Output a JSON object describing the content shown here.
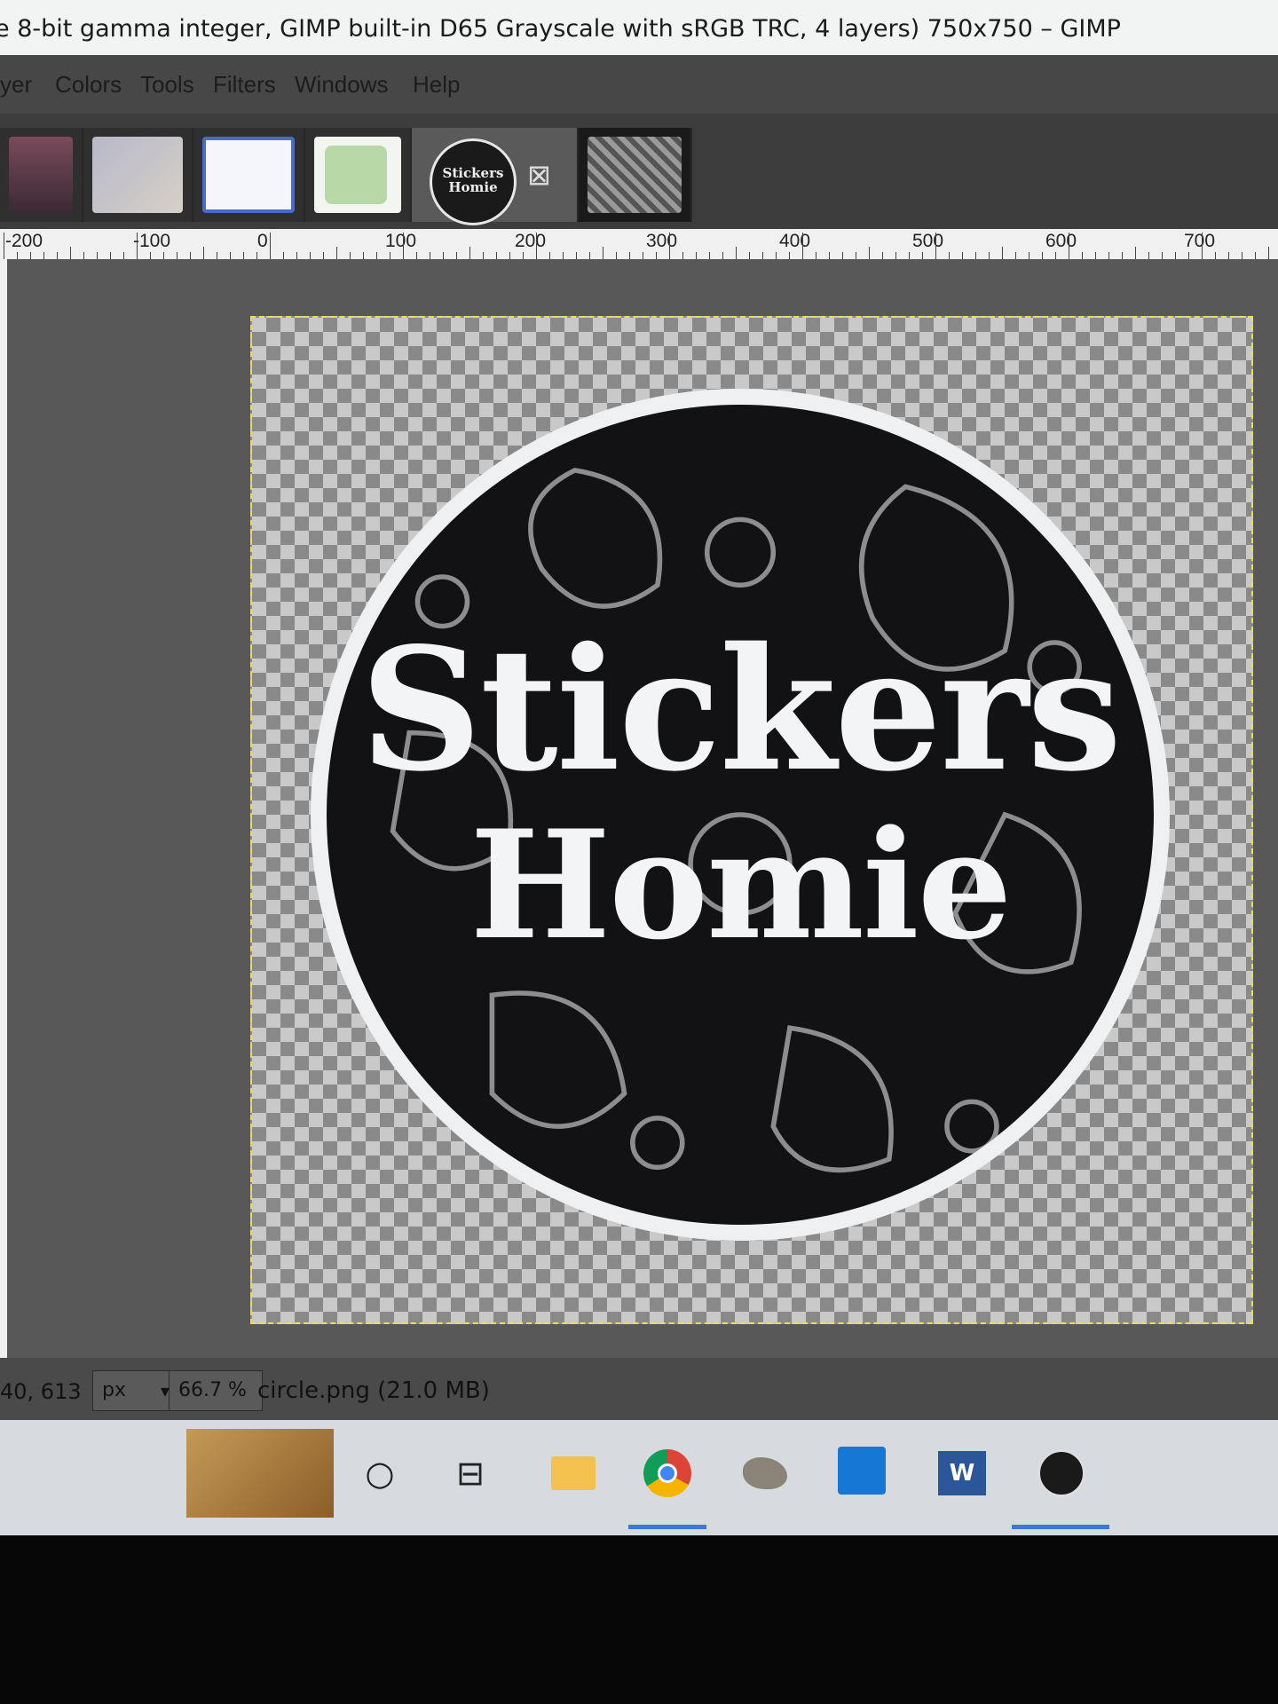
{
  "window": {
    "title": "e 8-bit gamma integer, GIMP built-in D65 Grayscale with sRGB TRC, 4 layers) 750x750 – GIMP"
  },
  "menu": {
    "items": [
      "yer",
      "Colors",
      "Tools",
      "Filters",
      "Windows",
      "Help"
    ]
  },
  "image_tabs": {
    "active_tab_label": "Stickers Homie",
    "close_glyph": "⊠"
  },
  "ruler": {
    "labels": [
      "-200",
      "-100",
      "0",
      "100",
      "200",
      "300",
      "400",
      "500",
      "600",
      "700"
    ]
  },
  "canvas": {
    "sticker_line1": "Stickers",
    "sticker_line2": "Homie"
  },
  "statusbar": {
    "pointer_coords": "40, 613",
    "unit": "px",
    "zoom": "66.7 %",
    "file_info": "circle.png (21.0 MB)"
  },
  "taskbar": {
    "icons": [
      "search-circle-icon",
      "task-view-icon",
      "file-explorer-icon",
      "chrome-icon",
      "gimp-icon",
      "photos-icon",
      "word-icon",
      "stickers-homie-icon"
    ],
    "word_label": "W"
  },
  "colors": {
    "canvas_bg": "#585858",
    "selection_border": "#e8e050",
    "taskbar_accent": "#3b78d8"
  }
}
